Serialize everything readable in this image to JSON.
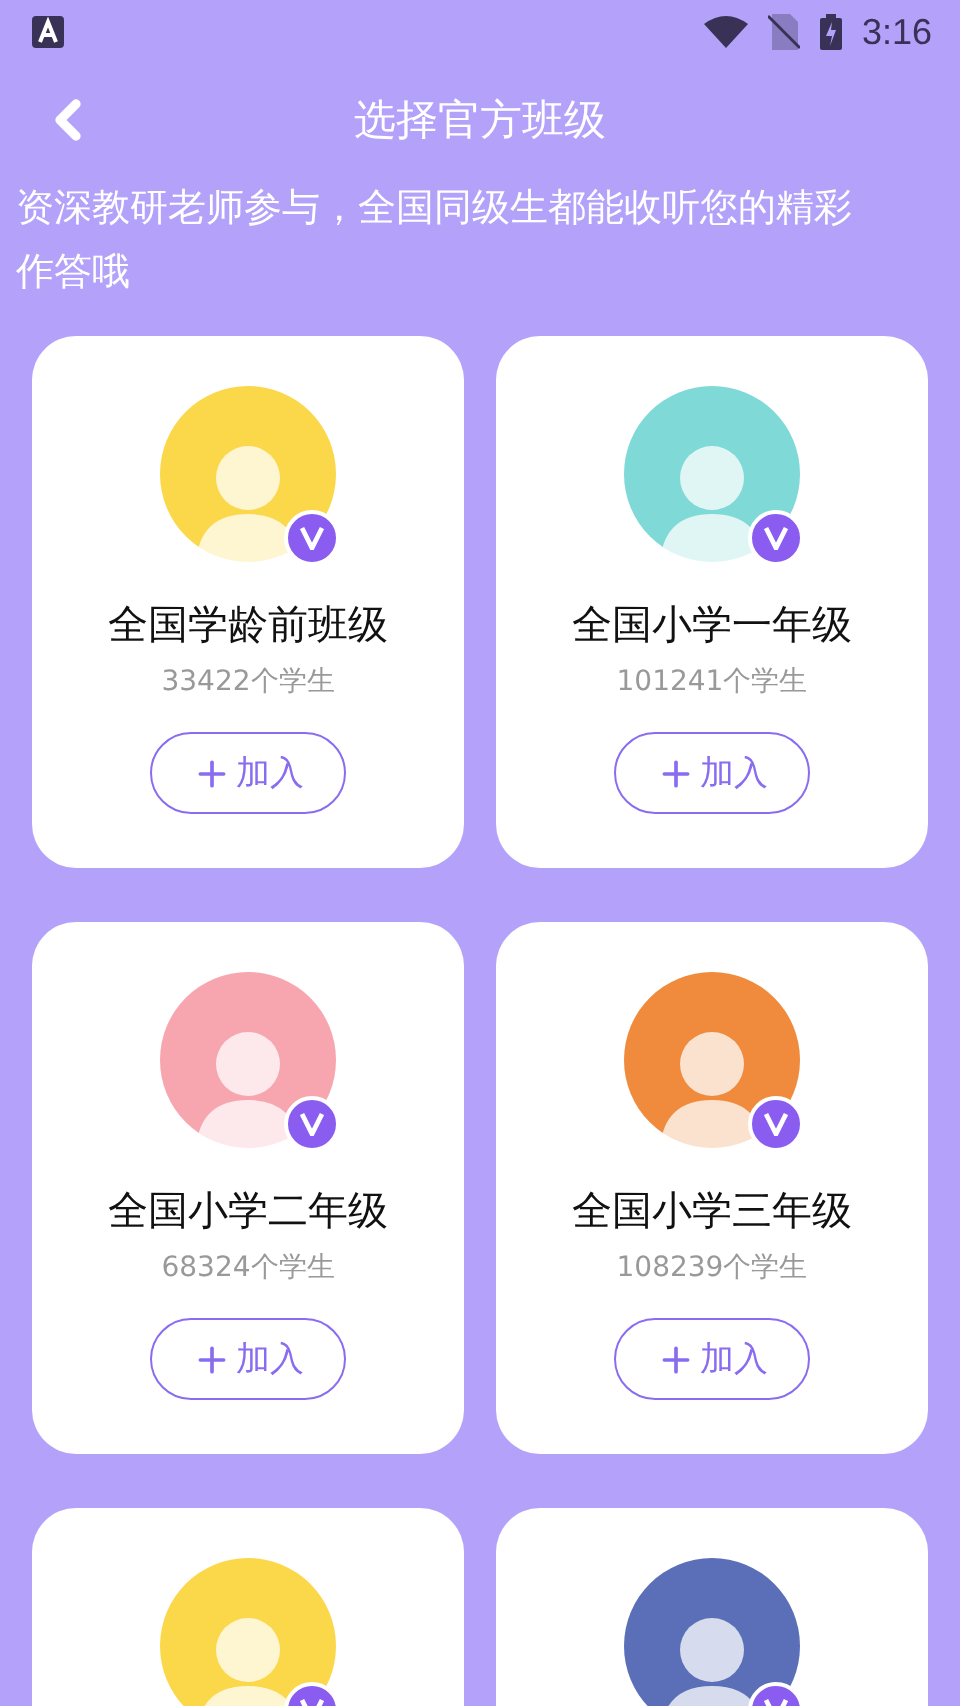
{
  "status_bar": {
    "time": "3:16"
  },
  "header": {
    "title": "选择官方班级"
  },
  "subtitle": "资深教研老师参与，全国同级生都能收听您的精彩作答哦",
  "classes": [
    {
      "name": "全国学龄前班级",
      "count": "33422个学生",
      "button": "加入",
      "color": "#fbd84a"
    },
    {
      "name": "全国小学一年级",
      "count": "101241个学生",
      "button": "加入",
      "color": "#7fd9d6"
    },
    {
      "name": "全国小学二年级",
      "count": "68324个学生",
      "button": "加入",
      "color": "#f7a6b0"
    },
    {
      "name": "全国小学三年级",
      "count": "108239个学生",
      "button": "加入",
      "color": "#f08a3c"
    },
    {
      "color": "#fbd84a"
    },
    {
      "color": "#5b6fb8"
    }
  ]
}
